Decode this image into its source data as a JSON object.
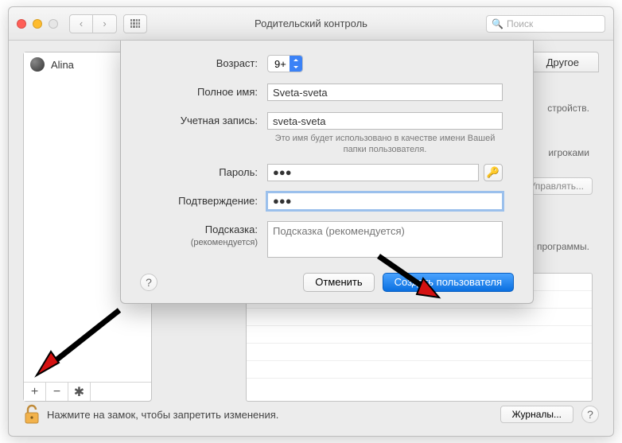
{
  "header": {
    "title": "Родительский контроль",
    "search_placeholder": "Поиск"
  },
  "sidebar": {
    "user": "Alina"
  },
  "tabs": {
    "other": "Другое"
  },
  "background": {
    "devices_hint": "стройств.",
    "players_hint": "игроками",
    "manage_label": "Управлять...",
    "programs_hint": "е программы."
  },
  "form": {
    "age_label": "Возраст:",
    "age_value": "9+",
    "fullname_label": "Полное имя:",
    "fullname_value": "Sveta-sveta",
    "account_label": "Учетная запись:",
    "account_value": "sveta-sveta",
    "account_hint": "Это имя будет использовано в качестве имени Вашей папки пользователя.",
    "password_label": "Пароль:",
    "password_value": "●●●",
    "confirm_label": "Подтверждение:",
    "confirm_value": "●●●",
    "hint_label": "Подсказка:",
    "hint_sublabel": "(рекомендуется)",
    "hint_placeholder": "Подсказка (рекомендуется)",
    "cancel": "Отменить",
    "create": "Создать пользователя"
  },
  "footer": {
    "lock_hint": "Нажмите на замок, чтобы запретить изменения.",
    "journals": "Журналы..."
  }
}
